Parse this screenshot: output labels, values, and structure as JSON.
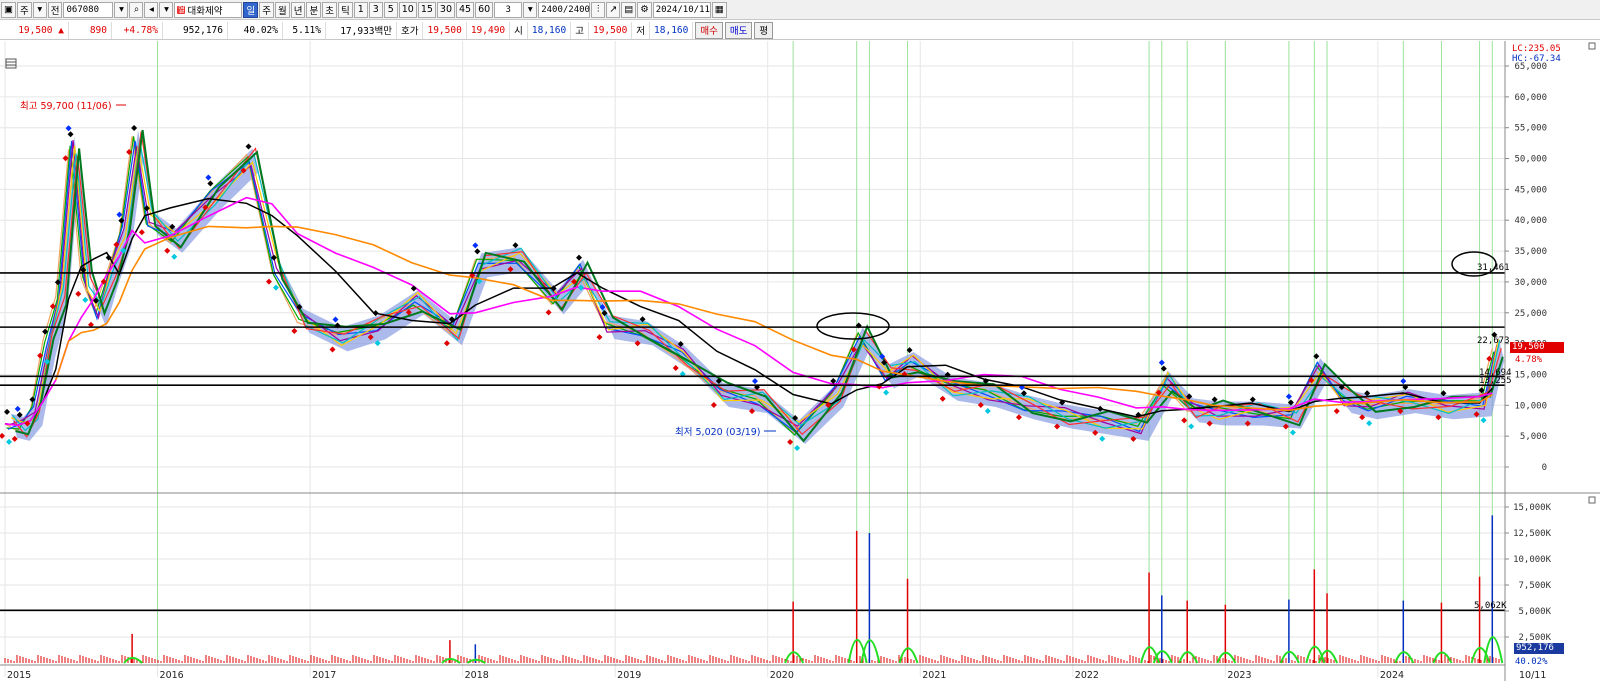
{
  "toolbar": {
    "period_label": "주",
    "prev_label": "전",
    "stock_code": "067080",
    "stock_name": "대화제약",
    "stock_badge": "열",
    "intervals": [
      "일",
      "주",
      "월",
      "년",
      "분",
      "초",
      "틱"
    ],
    "selected_interval": "일",
    "minute_presets": [
      "1",
      "3",
      "5",
      "10",
      "15",
      "30",
      "45",
      "60"
    ],
    "custom_interval": "3",
    "bar_count": "2400/2400",
    "date": "2024/10/11"
  },
  "quote": {
    "price": "19,500",
    "change_symbol": "▲",
    "change": "890",
    "change_pct": "+4.78%",
    "volume": "952,176",
    "vol_ratio": "40.02%",
    "turnover": "5.11%",
    "trade_value": "17,933백만",
    "hoga_label": "호가",
    "ask": "19,500",
    "bid": "19,490",
    "open_label": "시",
    "open": "18,160",
    "high_label": "고",
    "high": "19,500",
    "low_label": "저",
    "low": "18,160",
    "buy_button": "매수",
    "sell_button": "매도",
    "avg_button": "평"
  },
  "colors": {
    "up": "#e00000",
    "down": "#0030c0",
    "ichimoku_cloud": "#7f95e0",
    "ma_green": "#007a1f",
    "ma_magenta": "#ff00ff",
    "ma_orange": "#ff8a00",
    "signal_vline": "#9be29b"
  },
  "chart_data": {
    "type": "line",
    "x_labels": [
      "2015",
      "2016",
      "2017",
      "2018",
      "2019",
      "2020",
      "2021",
      "2022",
      "2023",
      "2024",
      "10/11"
    ],
    "price_axis": {
      "ticks": [
        "65,000",
        "60,000",
        "55,000",
        "50,000",
        "45,000",
        "40,000",
        "35,000",
        "30,000",
        "25,000",
        "20,000",
        "15,000",
        "10,000",
        "5,000",
        "0"
      ],
      "lc_label": "LC:235.05",
      "hc_label": "HC:-67.34",
      "ylim": [
        0,
        65000
      ]
    },
    "volume_axis": {
      "ticks": [
        "15,000K",
        "12,500K",
        "10,000K",
        "7,500K",
        "5,000K",
        "2,500K"
      ],
      "ylim": [
        0,
        15000
      ]
    },
    "support_resistance": [
      {
        "label": "31,461",
        "value": 31461
      },
      {
        "label": "22,673",
        "value": 22673
      },
      {
        "label": "14,694",
        "value": 14694
      },
      {
        "label": "13,255",
        "value": 13255
      }
    ],
    "volume_line": {
      "label": "5,062K",
      "value": 5062
    },
    "annotations": {
      "high": "최고 59,700 (11/06)",
      "low": "최저 5,020 (03/19)"
    },
    "last_price_tag": "19,500",
    "last_change_pct": "4.78%",
    "last_volume_tag": "952,176",
    "last_vol_pct": "40.02%",
    "close_series": [
      [
        "2015-01",
        7000
      ],
      [
        "2015-02",
        6500
      ],
      [
        "2015-03",
        9000
      ],
      [
        "2015-04",
        20000
      ],
      [
        "2015-05",
        28000
      ],
      [
        "2015-06",
        52000
      ],
      [
        "2015-07",
        30000
      ],
      [
        "2015-08",
        25000
      ],
      [
        "2015-09",
        32000
      ],
      [
        "2015-10",
        38000
      ],
      [
        "2015-11",
        53000
      ],
      [
        "2015-12",
        40000
      ],
      [
        "2016-02",
        37000
      ],
      [
        "2016-05",
        44000
      ],
      [
        "2016-08",
        50000
      ],
      [
        "2016-10",
        32000
      ],
      [
        "2016-12",
        24000
      ],
      [
        "2017-03",
        21000
      ],
      [
        "2017-06",
        23000
      ],
      [
        "2017-09",
        27000
      ],
      [
        "2017-12",
        22000
      ],
      [
        "2018-02",
        33000
      ],
      [
        "2018-05",
        34000
      ],
      [
        "2018-08",
        27000
      ],
      [
        "2018-10",
        32000
      ],
      [
        "2018-12",
        23000
      ],
      [
        "2019-03",
        22000
      ],
      [
        "2019-06",
        18000
      ],
      [
        "2019-09",
        12000
      ],
      [
        "2019-12",
        11000
      ],
      [
        "2020-03",
        6000
      ],
      [
        "2020-06",
        12000
      ],
      [
        "2020-08",
        21000
      ],
      [
        "2020-10",
        15000
      ],
      [
        "2020-12",
        17000
      ],
      [
        "2021-03",
        13000
      ],
      [
        "2021-06",
        12000
      ],
      [
        "2021-09",
        10000
      ],
      [
        "2021-12",
        8500
      ],
      [
        "2022-03",
        7500
      ],
      [
        "2022-06",
        6500
      ],
      [
        "2022-08",
        14000
      ],
      [
        "2022-10",
        9500
      ],
      [
        "2022-12",
        9000
      ],
      [
        "2023-03",
        9000
      ],
      [
        "2023-06",
        8500
      ],
      [
        "2023-08",
        16000
      ],
      [
        "2023-10",
        11000
      ],
      [
        "2023-12",
        10000
      ],
      [
        "2024-03",
        11000
      ],
      [
        "2024-06",
        10000
      ],
      [
        "2024-09",
        10500
      ],
      [
        "2024-10",
        19500
      ]
    ],
    "volume_spikes_k": [
      [
        "2015-11",
        2800
      ],
      [
        "2017-12",
        2200
      ],
      [
        "2018-02",
        1800
      ],
      [
        "2020-03",
        5900
      ],
      [
        "2020-08",
        12700
      ],
      [
        "2020-09",
        12500
      ],
      [
        "2020-12",
        8100
      ],
      [
        "2022-07",
        8700
      ],
      [
        "2022-08",
        6500
      ],
      [
        "2022-10",
        6000
      ],
      [
        "2023-01",
        5600
      ],
      [
        "2023-06",
        6100
      ],
      [
        "2023-08",
        9000
      ],
      [
        "2023-09",
        6700
      ],
      [
        "2024-03",
        6000
      ],
      [
        "2024-06",
        5800
      ],
      [
        "2024-09",
        8300
      ],
      [
        "2024-10",
        14200
      ]
    ]
  }
}
